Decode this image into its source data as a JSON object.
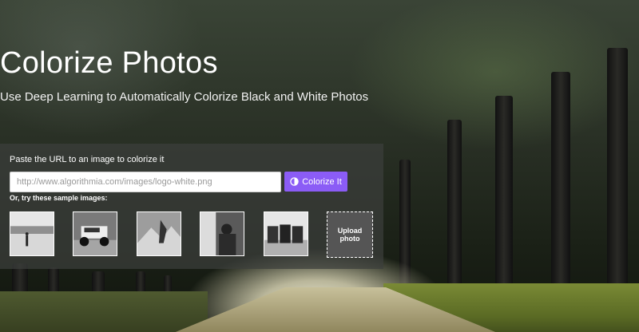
{
  "hero": {
    "title": "Colorize Photos",
    "subtitle": "Use Deep Learning to Automatically Colorize Black and White Photos"
  },
  "form": {
    "prompt": "Paste the URL to an image to colorize it",
    "url_placeholder": "http://www.algorithmia.com/images/logo-white.png",
    "submit_label": "Colorize It",
    "submit_icon": "contrast-icon",
    "samples_label": "Or, try these sample images:",
    "samples": [
      {
        "name": "sample-beach"
      },
      {
        "name": "sample-race-car"
      },
      {
        "name": "sample-mountain-person"
      },
      {
        "name": "sample-portrait"
      },
      {
        "name": "sample-cows"
      }
    ],
    "upload_label": "Upload photo"
  },
  "colors": {
    "accent": "#8b5cf6",
    "panel": "#3c3e3c"
  }
}
